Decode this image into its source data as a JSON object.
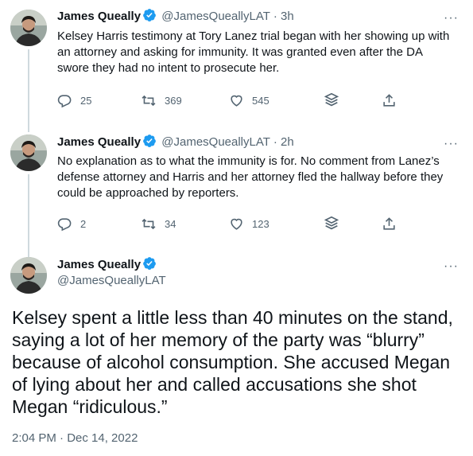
{
  "tweets": [
    {
      "name": "James Queally",
      "handle": "@JamesQueallyLAT",
      "time": "· 3h",
      "text": "Kelsey Harris testimony at Tory Lanez trial began with her showing up with an attorney and asking for immunity. It was granted even after the DA swore they had no intent to prosecute her.",
      "replies": "25",
      "retweets": "369",
      "likes": "545"
    },
    {
      "name": "James Queally",
      "handle": "@JamesQueallyLAT",
      "time": "· 2h",
      "text": "No explanation as to what the immunity is for. No comment from Lanez’s defense attorney and Harris and her attorney fled the hallway before they could be approached by reporters.",
      "replies": "2",
      "retweets": "34",
      "likes": "123"
    }
  ],
  "main_tweet": {
    "name": "James Queally",
    "handle": "@JamesQueallyLAT",
    "text": "Kelsey spent a little less than 40 minutes on the stand, saying a lot of her memory of the party was “blurry” because of alcohol consumption. She accused Megan of lying about her and called accusations she shot Megan “ridiculous.”",
    "timestamp": "2:04 PM · Dec 14, 2022"
  },
  "more_label": "···",
  "colors": {
    "verified": "#1d9bf0",
    "muted": "#536471",
    "thread_line": "#cfd9de"
  },
  "icons": [
    "reply-icon",
    "retweet-icon",
    "like-icon",
    "analytics-icon",
    "share-icon",
    "verified-icon"
  ]
}
